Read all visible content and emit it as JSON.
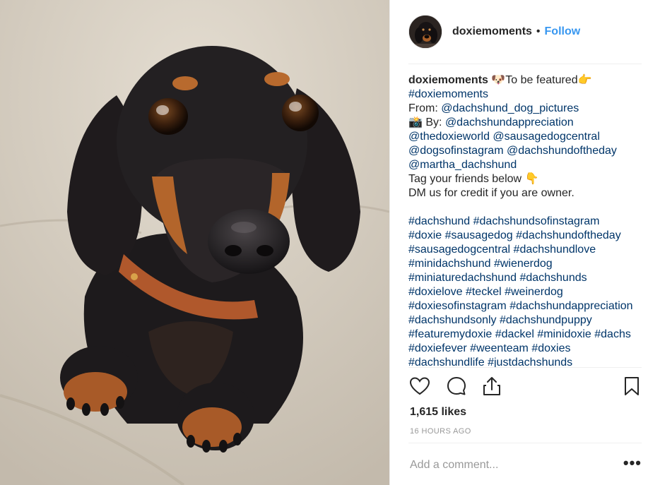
{
  "post": {
    "username": "doxiemoments",
    "separator": "•",
    "follow_label": "Follow",
    "avatar_alt": "doxiemoments profile picture"
  },
  "caption": {
    "username": "doxiemoments",
    "line1_text": " 🐶To be featured👉",
    "line2": "#doxiemoments",
    "line3_prefix": "From: ",
    "line3_mention": "@dachshund_dog_pictures",
    "line4_prefix": "📸 By: ",
    "line4_mention": "@dachshundappreciation",
    "line5": "@thedoxieworld @sausagedogcentral",
    "line6": "@dogsofinstagram @dachshundoftheday",
    "line7": "@martha_dachshund",
    "line8": "Tag your friends below 👇",
    "line9": "DM us for credit if you are owner.",
    "hashtag_lines": [
      "#dachshund #dachshundsofinstagram",
      "#doxie #sausagedog #dachshundoftheday",
      "#sausagedogcentral #dachshundlove",
      "#minidachshund #wienerdog",
      "#miniaturedachshund #dachshunds",
      "#doxielove #teckel #weinerdog",
      "#doxiesofinstagram #dachshundappreciation",
      "#dachshundsonly #dachshundpuppy",
      "#featuremydoxie #dackel #minidoxie #dachs",
      "#doxiefever #weenteam #doxies",
      "#dachshundlife #justdachshunds"
    ]
  },
  "actions": {
    "like_icon": "heart-icon",
    "comment_icon": "comment-icon",
    "share_icon": "share-icon",
    "save_icon": "bookmark-icon"
  },
  "likes": "1,615 likes",
  "timestamp": "16 HOURS AGO",
  "comment": {
    "placeholder": "Add a comment...",
    "more_label": "•••"
  },
  "colors": {
    "link": "#3897f0",
    "hashtag": "#003569",
    "muted": "#999999",
    "text": "#262626"
  }
}
